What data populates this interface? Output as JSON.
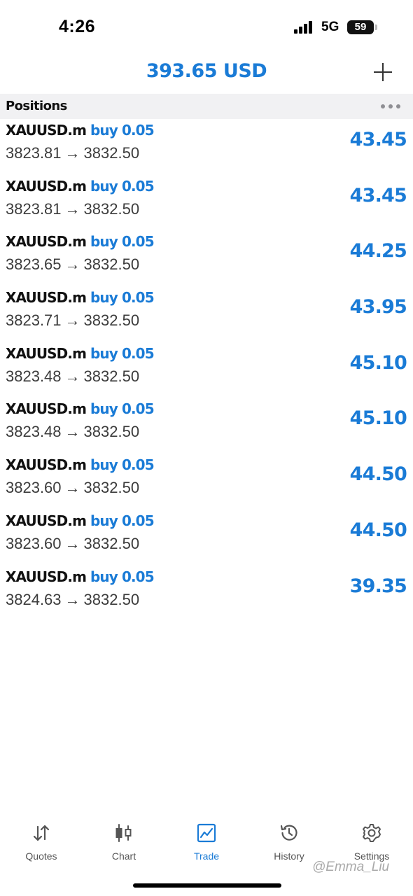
{
  "status_bar": {
    "time": "4:26",
    "network": "5G",
    "battery": "59"
  },
  "header": {
    "balance": "393.65 USD",
    "add_icon": "plus-icon"
  },
  "section": {
    "title": "Positions",
    "more_icon": "more-dots-icon"
  },
  "positions": [
    {
      "symbol": "XAUUSD.m",
      "type": "buy 0.05",
      "open_price": "3823.81",
      "arrow": "→",
      "current_price": "3832.50",
      "profit": "43.45"
    },
    {
      "symbol": "XAUUSD.m",
      "type": "buy 0.05",
      "open_price": "3823.81",
      "arrow": "→",
      "current_price": "3832.50",
      "profit": "43.45"
    },
    {
      "symbol": "XAUUSD.m",
      "type": "buy 0.05",
      "open_price": "3823.65",
      "arrow": "→",
      "current_price": "3832.50",
      "profit": "44.25"
    },
    {
      "symbol": "XAUUSD.m",
      "type": "buy 0.05",
      "open_price": "3823.71",
      "arrow": "→",
      "current_price": "3832.50",
      "profit": "43.95"
    },
    {
      "symbol": "XAUUSD.m",
      "type": "buy 0.05",
      "open_price": "3823.48",
      "arrow": "→",
      "current_price": "3832.50",
      "profit": "45.10"
    },
    {
      "symbol": "XAUUSD.m",
      "type": "buy 0.05",
      "open_price": "3823.48",
      "arrow": "→",
      "current_price": "3832.50",
      "profit": "45.10"
    },
    {
      "symbol": "XAUUSD.m",
      "type": "buy 0.05",
      "open_price": "3823.60",
      "arrow": "→",
      "current_price": "3832.50",
      "profit": "44.50"
    },
    {
      "symbol": "XAUUSD.m",
      "type": "buy 0.05",
      "open_price": "3823.60",
      "arrow": "→",
      "current_price": "3832.50",
      "profit": "44.50"
    },
    {
      "symbol": "XAUUSD.m",
      "type": "buy 0.05",
      "open_price": "3824.63",
      "arrow": "→",
      "current_price": "3832.50",
      "profit": "39.35"
    }
  ],
  "tabs": [
    {
      "label": "Quotes",
      "icon": "quotes-arrows-icon",
      "active": false
    },
    {
      "label": "Chart",
      "icon": "candlestick-chart-icon",
      "active": false
    },
    {
      "label": "Trade",
      "icon": "trade-chart-icon",
      "active": true
    },
    {
      "label": "History",
      "icon": "history-clock-icon",
      "active": false
    },
    {
      "label": "Settings",
      "icon": "gear-icon",
      "active": false
    }
  ],
  "watermark": "@Emma_Liu",
  "colors": {
    "accent": "#1a7bd6",
    "section_bg": "#f1f1f3",
    "text_primary": "#111111",
    "text_secondary": "#3c3c3c",
    "tab_inactive": "#555555"
  }
}
